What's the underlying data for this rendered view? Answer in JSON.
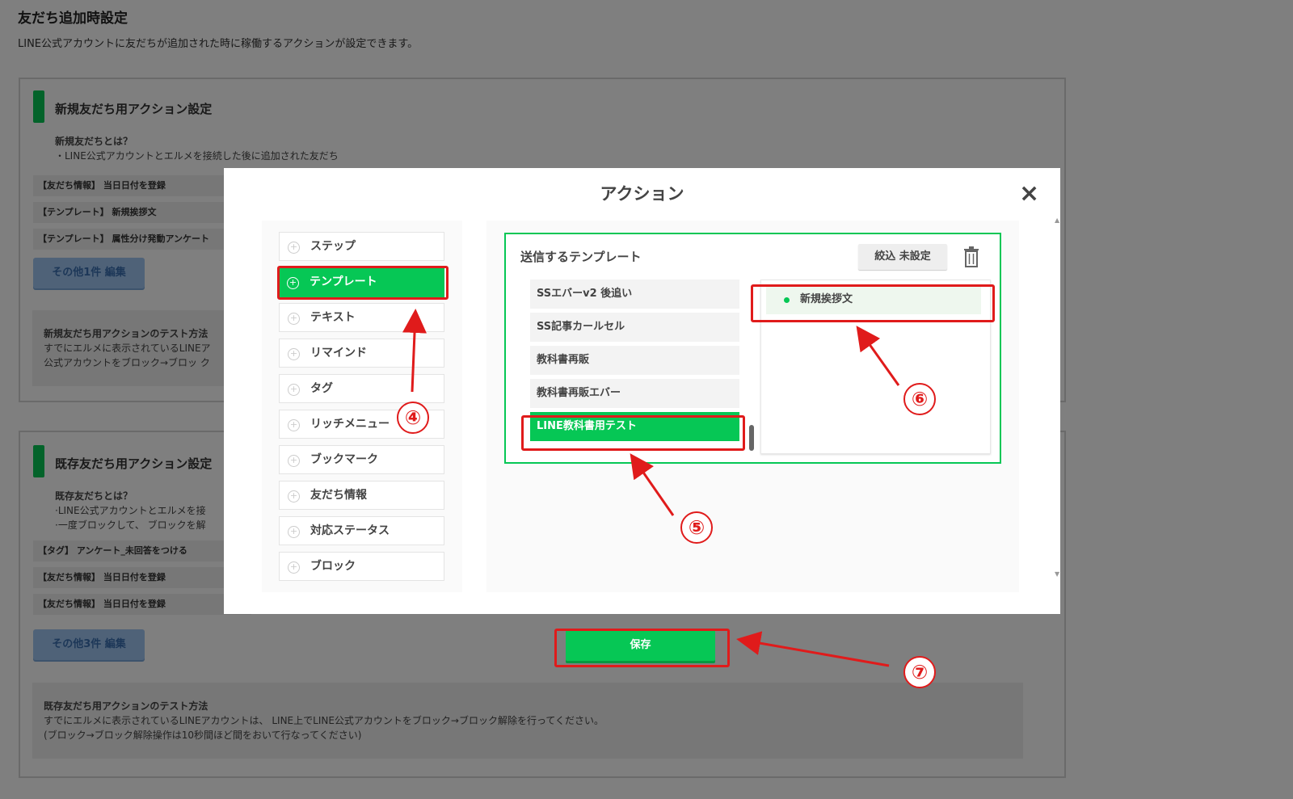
{
  "page": {
    "title": "友だち追加時設定",
    "description": "LINE公式アカウントに友だちが追加された時に稼働するアクションが設定できます。"
  },
  "new_friends": {
    "title": "新規友だち用アクション設定",
    "what_label": "新規友だちとは？",
    "what_desc": "・LINE公式アカウントとエルメを接続した後に追加された友だち",
    "rows": [
      "【友だち情報】 当日日付を登録",
      "【テンプレート】 新規挨拶文",
      "【テンプレート】 属性分け発動アンケート"
    ],
    "more_button": "その他1件 編集",
    "test_title": "新規友だち用アクションのテスト方法",
    "test_line1": "すでにエルメに表示されているLINEア",
    "test_line2": "公式アカウントをブロック→ブロッ ク"
  },
  "existing_friends": {
    "title": "既存友だち用アクション設定",
    "what_label": "既存友だちとは？",
    "what_desc1": "·LINE公式アカウントとエルメを接",
    "what_desc2": "·一度ブロックして、 ブロックを解",
    "rows": [
      "【タグ】 アンケート_未回答をつける",
      "【友だち情報】 当日日付を登録",
      "【友だち情報】 当日日付を登録"
    ],
    "more_button": "その他3件 編集",
    "test_title": "既存友だち用アクションのテスト方法",
    "test_line1": "すでにエルメに表示されているLINEアカウントは、 LINE上でLINE公式アカウントをブロック→ブロック解除を行ってください。",
    "test_line2": "(ブロック→ブロック解除操作は10秒間ほど間をおいて行なってください)"
  },
  "modal": {
    "title": "アクション",
    "close": "×",
    "menu": [
      "ステップ",
      "テンプレート",
      "テキスト",
      "リマインド",
      "タグ",
      "リッチメニュー",
      "ブックマーク",
      "友だち情報",
      "対応ステータス",
      "ブロック"
    ],
    "active_index": 1,
    "send_label": "送信するテンプレート",
    "filter_button": "絞込 未設定",
    "templates": [
      "SSエバーv2 後追い",
      "SS記事カールセル",
      "教科書再販",
      "教科書再販エバー",
      "LINE教科書用テスト"
    ],
    "selected_template_index": 4,
    "chosen": "新規挨拶文"
  },
  "save_button": "保存",
  "annotations": [
    "④",
    "⑤",
    "⑥",
    "⑦"
  ],
  "colors": {
    "accent": "#06c755",
    "highlight": "#e01b1b",
    "link_button": "#9ec5f0"
  }
}
